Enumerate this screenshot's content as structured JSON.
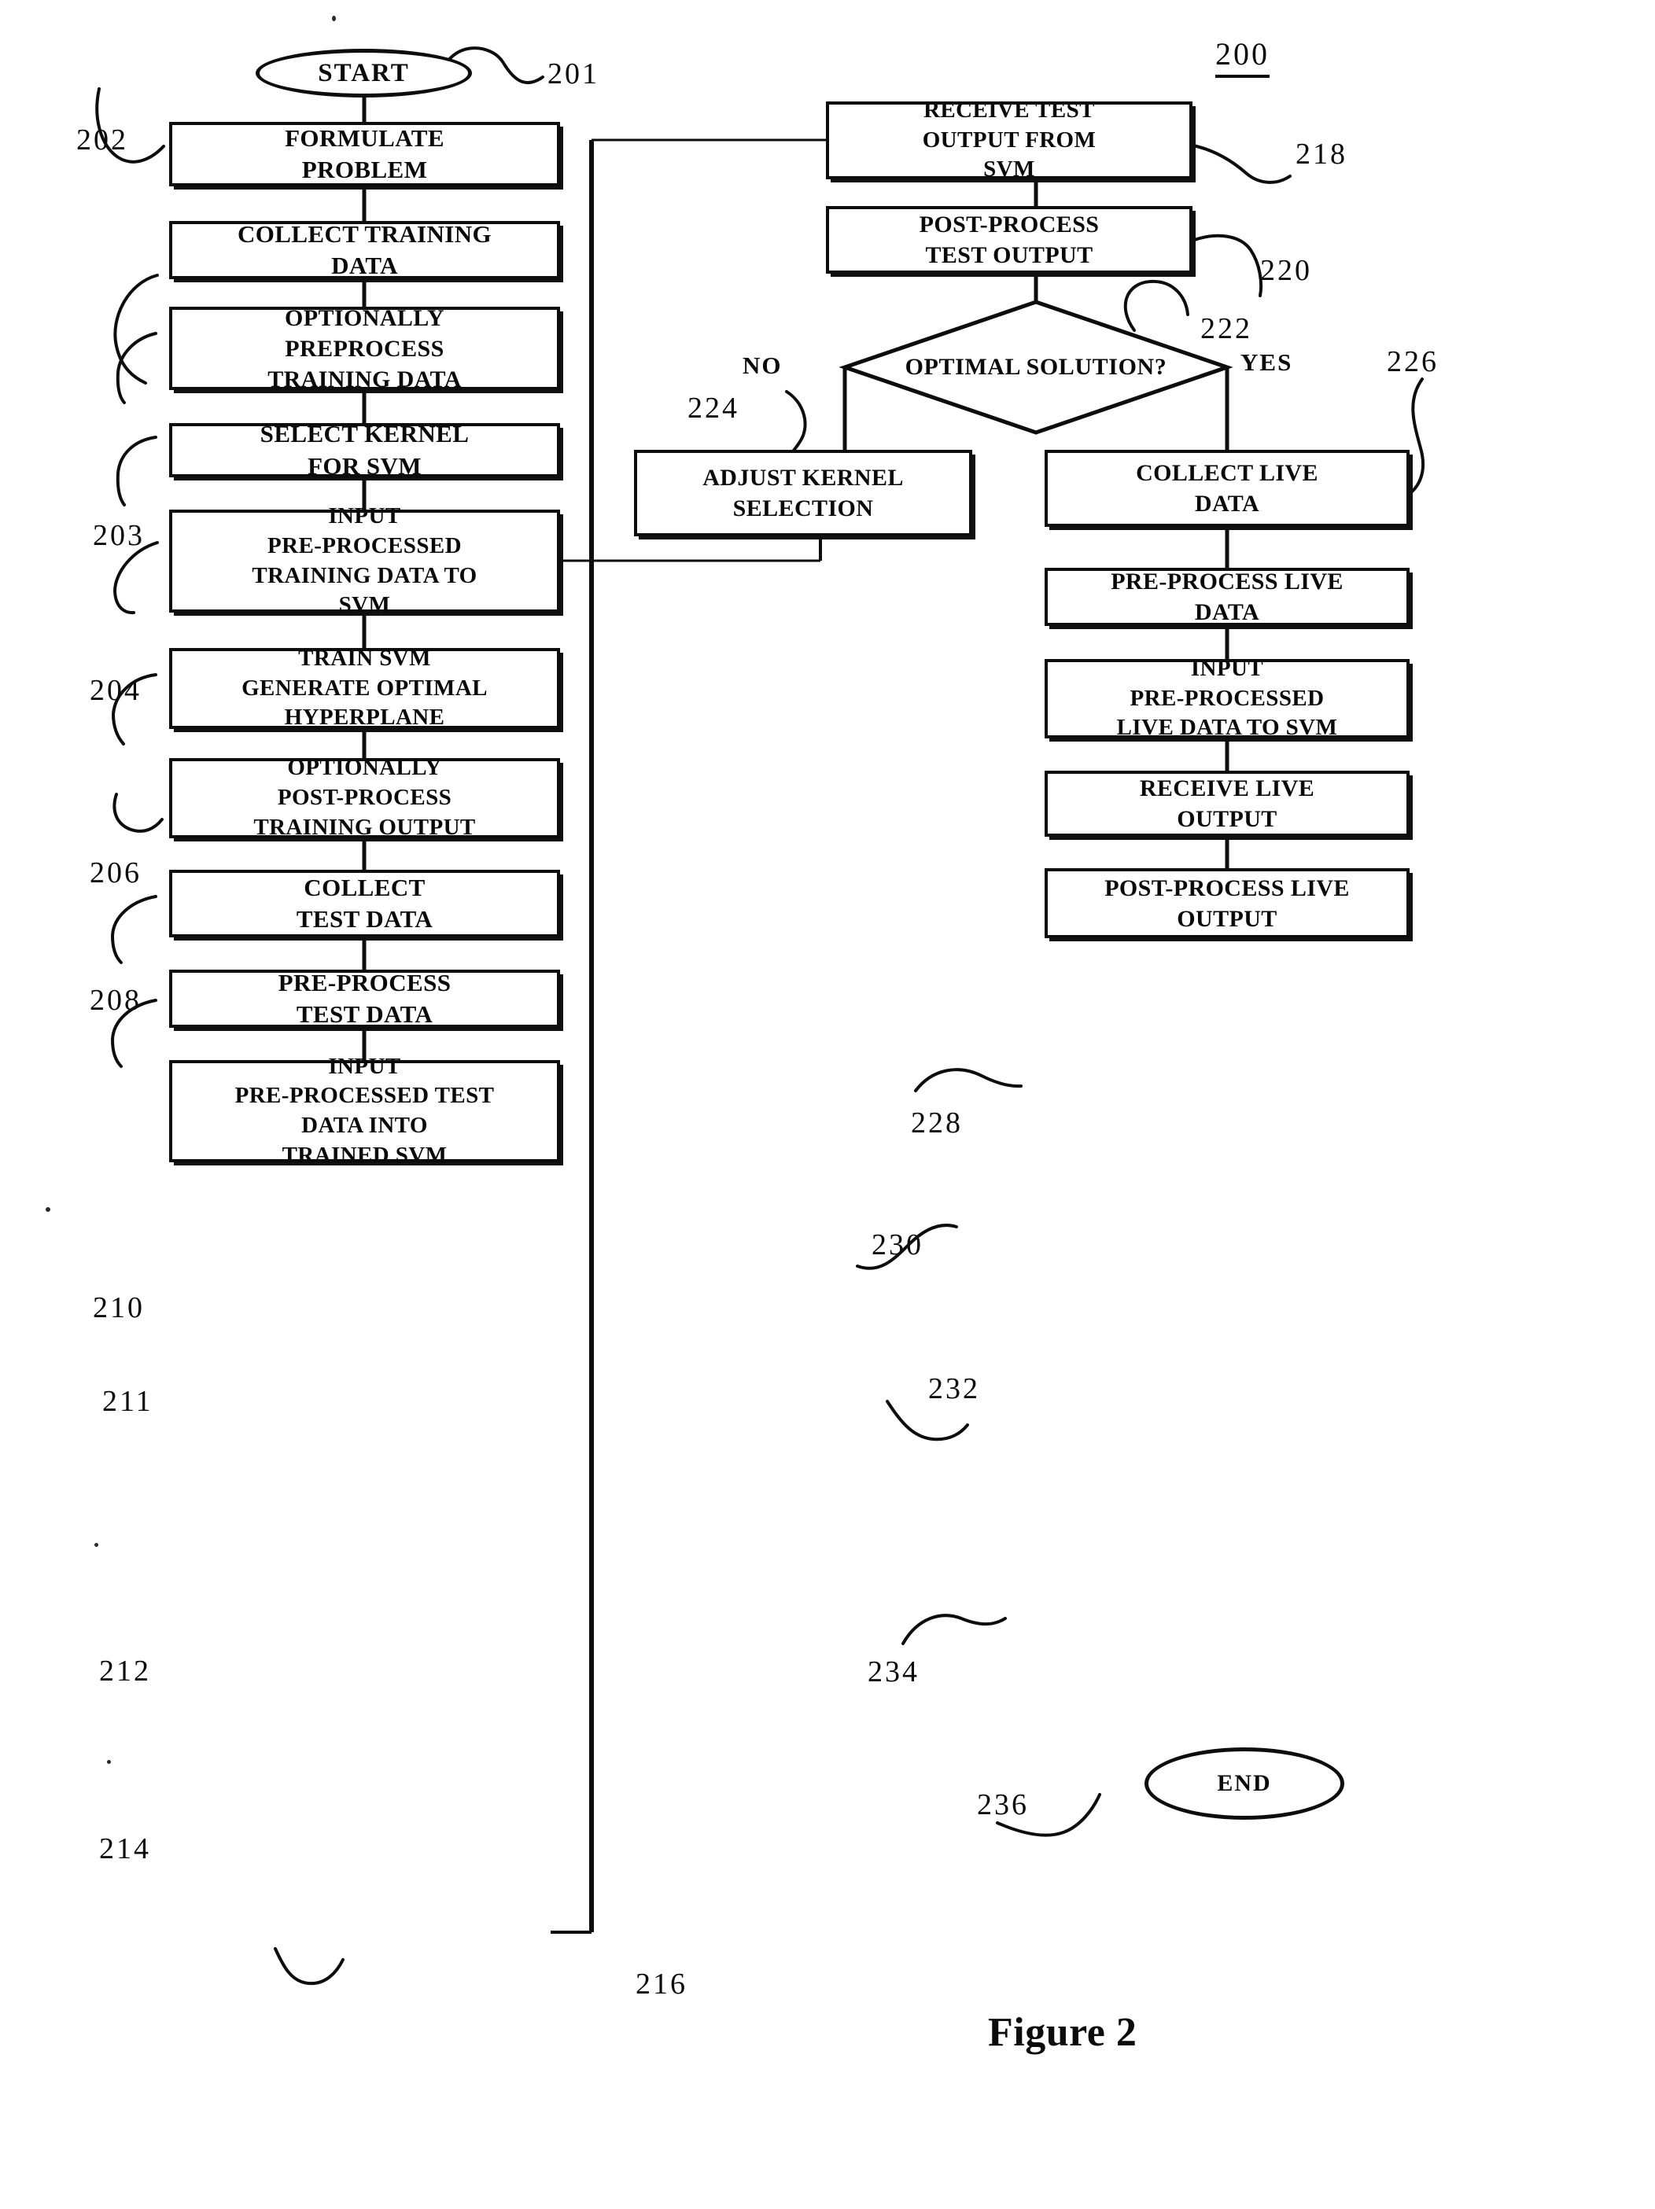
{
  "figure": {
    "title": "Figure 2",
    "diagram_number": "200"
  },
  "terminals": [
    {
      "id": "start",
      "label": "START",
      "ref": "201"
    },
    {
      "id": "end",
      "label": "END",
      "ref": "236"
    }
  ],
  "left_column": [
    {
      "ref": "202",
      "lines": [
        "FORMULATE",
        "PROBLEM"
      ]
    },
    {
      "ref": "203",
      "lines": [
        "COLLECT TRAINING",
        "DATA"
      ]
    },
    {
      "ref": "204",
      "lines": [
        "OPTIONALLY",
        "PREPROCESS",
        "TRAINING DATA"
      ]
    },
    {
      "ref": "206",
      "lines": [
        "SELECT KERNEL",
        "FOR SVM"
      ]
    },
    {
      "ref": "208",
      "lines": [
        "INPUT",
        "PRE-PROCESSED",
        "TRAINING DATA TO",
        "SVM"
      ]
    },
    {
      "ref": "210",
      "lines": [
        "TRAIN SVM",
        "GENERATE OPTIMAL",
        "HYPERPLANE"
      ]
    },
    {
      "ref": "211",
      "lines": [
        "OPTIONALLY",
        "POST-PROCESS",
        "TRAINING OUTPUT"
      ]
    },
    {
      "ref": "212",
      "lines": [
        "COLLECT",
        "TEST DATA"
      ]
    },
    {
      "ref": "214",
      "lines": [
        "PRE-PROCESS",
        "TEST DATA"
      ]
    },
    {
      "ref": "216",
      "lines": [
        "INPUT",
        "PRE-PROCESSED TEST",
        "DATA INTO",
        "TRAINED SVM"
      ]
    }
  ],
  "right_column": [
    {
      "ref": "218",
      "lines": [
        "RECEIVE TEST",
        "OUTPUT FROM",
        "SVM"
      ]
    },
    {
      "ref": "220",
      "lines": [
        "POST-PROCESS",
        "TEST OUTPUT"
      ]
    },
    {
      "ref": "226",
      "lines": [
        "COLLECT LIVE",
        "DATA"
      ]
    },
    {
      "ref": "228",
      "lines": [
        "PRE-PROCESS LIVE",
        "DATA"
      ]
    },
    {
      "ref": "230",
      "lines": [
        "INPUT",
        "PRE-PROCESSED",
        "LIVE DATA TO SVM"
      ]
    },
    {
      "ref": "232",
      "lines": [
        "RECEIVE LIVE",
        "OUTPUT"
      ]
    },
    {
      "ref": "234",
      "lines": [
        "POST-PROCESS LIVE",
        "OUTPUT"
      ]
    }
  ],
  "decision": {
    "ref": "222",
    "label": "OPTIMAL SOLUTION?",
    "branch_no": "NO",
    "branch_yes": "YES"
  },
  "adjust": {
    "ref": "224",
    "lines": [
      "ADJUST KERNEL",
      "SELECTION"
    ]
  },
  "colors": {
    "ink": "#0d0d0d",
    "paper": "#ffffff"
  }
}
